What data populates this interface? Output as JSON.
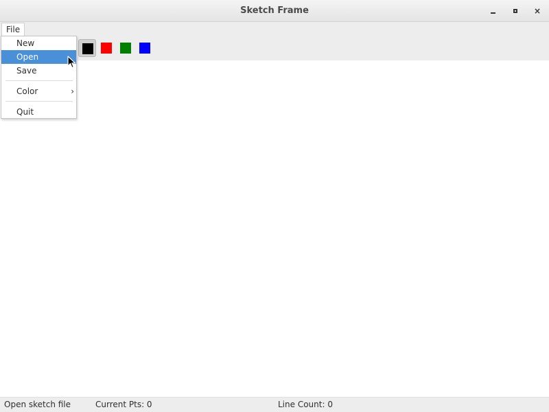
{
  "window": {
    "title": "Sketch Frame",
    "minimize_label": "_",
    "maximize_label": "□",
    "close_label": "×"
  },
  "menubar": {
    "file_label": "File"
  },
  "file_menu": {
    "items": [
      {
        "label": "New",
        "highlighted": false
      },
      {
        "label": "Open",
        "highlighted": true
      },
      {
        "label": "Save",
        "highlighted": false
      },
      {
        "label": "Color",
        "has_submenu": true,
        "arrow": "›"
      },
      {
        "label": "Quit",
        "highlighted": false
      }
    ]
  },
  "toolbar": {
    "colors": [
      {
        "name": "black",
        "hex": "#000000",
        "selected": true
      },
      {
        "name": "red",
        "hex": "#ff0000",
        "selected": false
      },
      {
        "name": "green",
        "hex": "#008000",
        "selected": false
      },
      {
        "name": "blue",
        "hex": "#0000ff",
        "selected": false
      }
    ]
  },
  "statusbar": {
    "message": "Open sketch file",
    "current_pts": "Current Pts: 0",
    "line_count": "Line Count: 0"
  },
  "theme": {
    "highlight": "#4a90d9",
    "chrome": "#ededed"
  }
}
